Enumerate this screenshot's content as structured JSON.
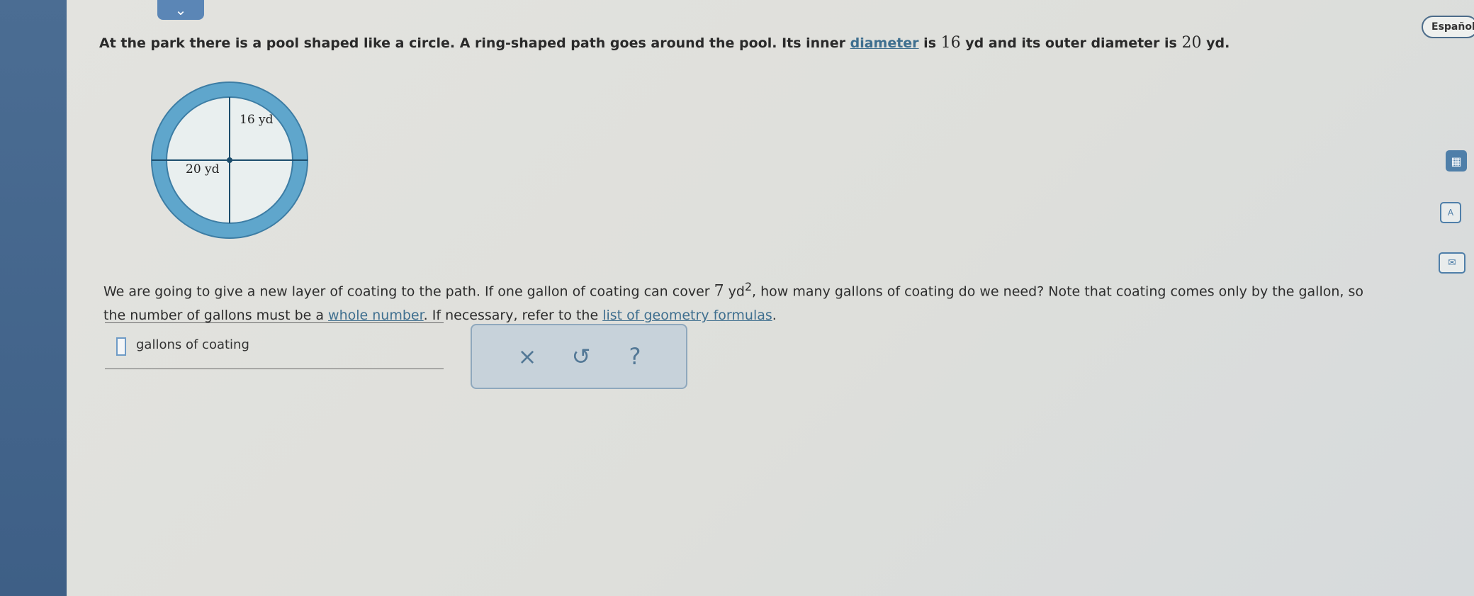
{
  "nav": {
    "collapse_icon": "chevron-down-icon",
    "language_label": "Español"
  },
  "problem": {
    "p1": "At the park there is a pool shaped like a circle. A ring-shaped path goes around the pool. Its inner ",
    "diameter_link": "diameter",
    "p2": " is ",
    "inner_value": "16",
    "p3": " yd and its outer diameter is ",
    "outer_value": "20",
    "p4": " yd."
  },
  "figure": {
    "inner_label": "16 yd",
    "outer_label": "20 yd",
    "ring_color": "#5fa6cc",
    "pool_color": "#e9efef"
  },
  "question": {
    "q1": "We are going to give a new layer of coating to the path. If one gallon of coating can cover ",
    "coverage_value": "7",
    "unit": "yd",
    "exponent": "2",
    "q2": ", how many gallons of coating do we need? Note that coating comes only by the gallon, so the number of gallons must be a ",
    "whole_number_link": "whole number",
    "q3": ". If necessary, refer to the ",
    "formulas_link": "list of geometry formulas",
    "q4": "."
  },
  "answer": {
    "value": "",
    "unit_label": "gallons of coating"
  },
  "tools": {
    "clear": "×",
    "undo": "↺",
    "help": "?"
  },
  "side_icons": [
    "calculator-icon",
    "text-icon",
    "mail-icon"
  ]
}
